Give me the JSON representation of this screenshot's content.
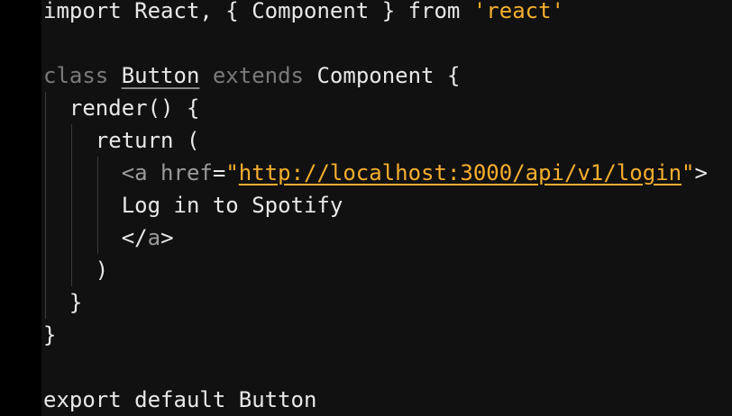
{
  "editor": {
    "line1": {
      "kw_import": "import",
      "rest": " React, { Component } from ",
      "module": "'react'"
    },
    "line3": {
      "kw_class": "class",
      "class_name": "Button",
      "kw_extends": "extends",
      "rest": " Component {"
    },
    "line4": {
      "text": "  render() {"
    },
    "line5": {
      "text": "    return ("
    },
    "line6": {
      "indent": "      ",
      "open_bracket": "<",
      "tag_name": "a",
      "attr_name": " href",
      "equals": "=",
      "quote_open": "\"",
      "url": "http://localhost:3000/api/v1/login",
      "quote_close": "\"",
      "close_bracket": ">"
    },
    "line7": {
      "text": "      Log in to Spotify"
    },
    "line8": {
      "indent": "      ",
      "open_bracket": "</",
      "tag_name": "a",
      "close_bracket": ">"
    },
    "line9": {
      "text": "    )"
    },
    "line10": {
      "text": "  }"
    },
    "line11": {
      "text": "}"
    },
    "line13": {
      "text": "export default Button"
    }
  },
  "colors": {
    "background": "#111111",
    "gutter": "#000000",
    "text": "#e8e8e8",
    "string": "#f5ae2e",
    "muted": "#7a7a7a"
  }
}
